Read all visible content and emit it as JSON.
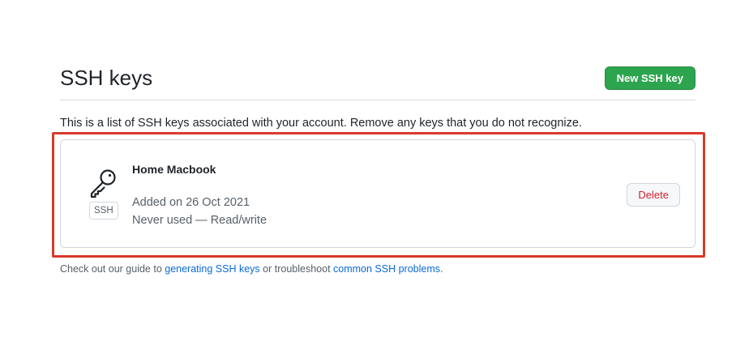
{
  "header": {
    "title": "SSH keys",
    "new_button_label": "New SSH key"
  },
  "description": "This is a list of SSH keys associated with your account. Remove any keys that you do not recognize.",
  "keys": [
    {
      "name": "Home Macbook",
      "type_badge": "SSH",
      "icon": "key-icon",
      "added": "Added on 26 Oct 2021",
      "usage": "Never used — Read/write",
      "delete_label": "Delete"
    }
  ],
  "footer": {
    "prefix": "Check out our guide to ",
    "link1": "generating SSH keys",
    "middle": " or troubleshoot ",
    "link2": "common SSH problems",
    "suffix": "."
  },
  "colors": {
    "primary_button": "#2da44e",
    "danger_text": "#cf222e",
    "link": "#0969da",
    "highlight_border": "#d93a2b"
  }
}
